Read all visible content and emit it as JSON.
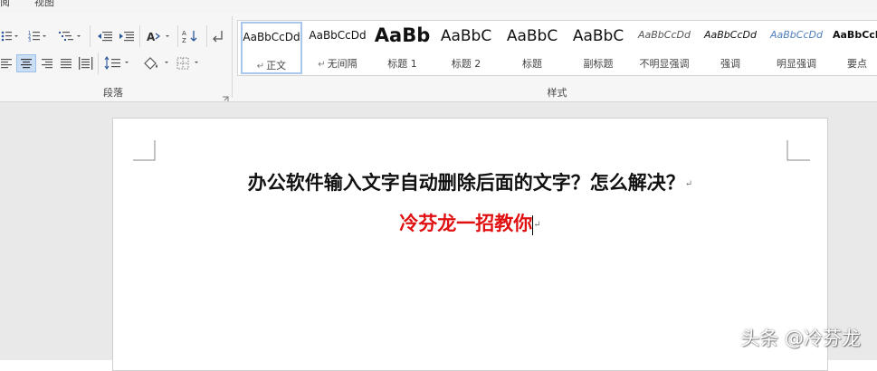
{
  "tabs": {
    "review": "阅",
    "view": "视图"
  },
  "paragraph_group": {
    "label": "段落"
  },
  "styles_group": {
    "label": "样式",
    "items": [
      {
        "sample": "AaBbCcDd",
        "name": "正文",
        "selected": true
      },
      {
        "sample": "AaBbCcDd",
        "name": "无间隔"
      },
      {
        "sample": "AaBb",
        "name": "标题 1"
      },
      {
        "sample": "AaBbC",
        "name": "标题 2"
      },
      {
        "sample": "AaBbC",
        "name": "标题"
      },
      {
        "sample": "AaBbC",
        "name": "副标题"
      },
      {
        "sample": "AaBbCcDd",
        "name": "不明显强调"
      },
      {
        "sample": "AaBbCcDd",
        "name": "强调"
      },
      {
        "sample": "AaBbCcDd",
        "name": "明显强调"
      },
      {
        "sample": "AaBbCcDd",
        "name": "要点"
      }
    ]
  },
  "document": {
    "title": "办公软件输入文字自动删除后面的文字？怎么解决？",
    "subtitle": "冷芬龙一招教你",
    "paragraph_mark": "↵",
    "subtitle_color": "#e01010"
  },
  "watermark": "头条 @冷芬龙",
  "colors": {
    "accent": "#2b579a",
    "selection": "#c9def5"
  }
}
